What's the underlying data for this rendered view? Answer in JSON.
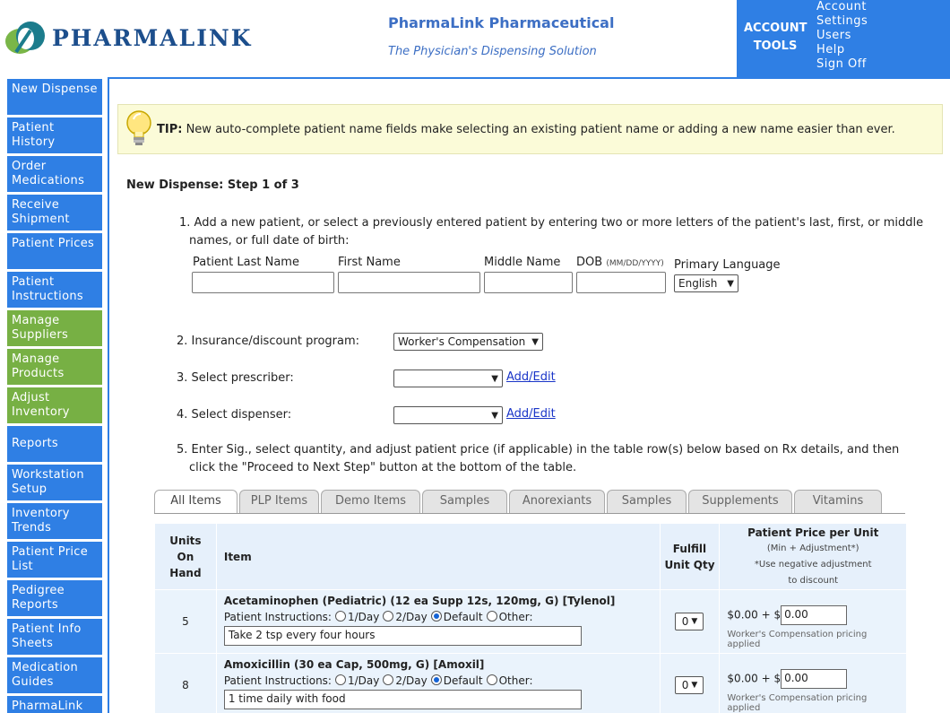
{
  "brand": {
    "logo_text": "PHARMALINK",
    "title": "PharmaLink Pharmaceutical",
    "subtitle": "The Physician's Dispensing Solution"
  },
  "account": {
    "label_line1": "ACCOUNT",
    "label_line2": "TOOLS",
    "links": [
      "Account Settings",
      "Users",
      "Help",
      "Sign Off"
    ]
  },
  "sidebar": {
    "items": [
      {
        "label": "New Dispense",
        "color": "#2f7fe4"
      },
      {
        "label": "Patient History",
        "color": "#2f7fe4"
      },
      {
        "label": "Order Medications",
        "color": "#2f7fe4"
      },
      {
        "label": "Receive Shipment",
        "color": "#2f7fe4"
      },
      {
        "label": "Patient Prices",
        "color": "#2f7fe4"
      },
      {
        "label": "Patient Instructions",
        "color": "#2f7fe4"
      },
      {
        "label": "Manage Suppliers",
        "color": "#77b044"
      },
      {
        "label": "Manage Products",
        "color": "#77b044"
      },
      {
        "label": "Adjust Inventory",
        "color": "#77b044"
      },
      {
        "label": "Reports",
        "color": "#2f7fe4"
      },
      {
        "label": "Workstation Setup",
        "color": "#2f7fe4"
      },
      {
        "label": "Inventory Trends",
        "color": "#2f7fe4"
      },
      {
        "label": "Patient Price List",
        "color": "#2f7fe4"
      },
      {
        "label": "Pedigree Reports",
        "color": "#2f7fe4"
      },
      {
        "label": "Patient Info Sheets",
        "color": "#2f7fe4"
      },
      {
        "label": "Medication Guides",
        "color": "#2f7fe4"
      },
      {
        "label": "PharmaLink",
        "color": "#2f7fe4"
      }
    ]
  },
  "tip": {
    "label": "TIP:",
    "text": "New auto-complete patient name fields make selecting an existing patient name or adding a new name easier than ever."
  },
  "form": {
    "step_title": "New Dispense: Step 1 of 3",
    "step1_line1": "1. Add a new patient, or select a previously entered patient by entering two or more letters of the patient's last, first, or middle",
    "step1_line2": "names, or full date of birth:",
    "fields": {
      "last_name_label": "Patient Last Name",
      "first_name_label": "First Name",
      "middle_name_label": "Middle Name",
      "dob_label": "DOB",
      "dob_hint": "(MM/DD/YYYY)",
      "language_label": "Primary Language",
      "language_value": "English",
      "last_name_value": "",
      "first_name_value": "",
      "middle_name_value": "",
      "dob_value": ""
    },
    "step2_label": "2. Insurance/discount program:",
    "step2_value": "Worker's Compensation",
    "step3_label": "3. Select prescriber:",
    "step3_value": "",
    "step4_label": "4. Select dispenser:",
    "step4_value": "",
    "add_edit_label": "Add/Edit",
    "step5_line1": "5. Enter Sig., select quantity, and adjust patient price (if applicable) in the table row(s) below based on Rx details, and then",
    "step5_line2": "click the \"Proceed to Next Step\" button at the bottom of the table."
  },
  "tabs": [
    {
      "label": "All Items",
      "active": true
    },
    {
      "label": "PLP Items",
      "active": false
    },
    {
      "label": "Demo Items",
      "active": false
    },
    {
      "label": "Samples",
      "active": false
    },
    {
      "label": "Anorexiants",
      "active": false
    },
    {
      "label": "Samples",
      "active": false
    },
    {
      "label": "Supplements",
      "active": false
    },
    {
      "label": "Vitamins",
      "active": false
    }
  ],
  "table": {
    "headers": {
      "units_line1": "Units",
      "units_line2": "On",
      "units_line3": "Hand",
      "item": "Item",
      "fulfill_line1": "Fulfill",
      "fulfill_line2": "Unit Qty",
      "price_title": "Patient Price per Unit",
      "price_sub1": "(Min + Adjustment*)",
      "price_sub2": "*Use negative adjustment",
      "price_sub3": "to discount"
    },
    "instructions_label": "Patient Instructions:",
    "options": [
      "1/Day",
      "2/Day",
      "Default",
      "Other:"
    ],
    "rows": [
      {
        "units": "5",
        "item": "Acetaminophen (Pediatric) (12 ea Supp 12s, 120mg, G) [Tylenol]",
        "instructions": "Take 2 tsp every four hours",
        "qty": "0",
        "price_prefix": "$0.00 + $",
        "price_value": "0.00",
        "pricing_note": "Worker's Compensation pricing applied"
      },
      {
        "units": "8",
        "item": "Amoxicillin (30 ea Cap, 500mg, G) [Amoxil]",
        "instructions": "1 time daily with food",
        "qty": "0",
        "price_prefix": "$0.00 + $",
        "price_value": "0.00",
        "pricing_note": "Worker's Compensation pricing applied"
      }
    ]
  }
}
